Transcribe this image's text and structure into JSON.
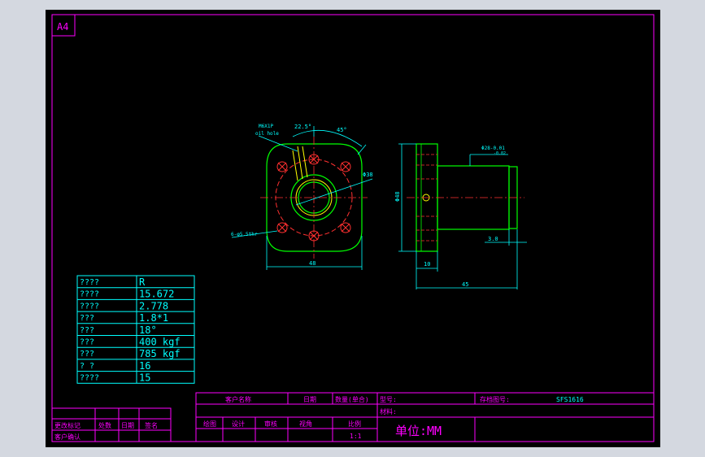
{
  "sheet": {
    "size_label": "A4"
  },
  "parameter_table": {
    "rows": [
      {
        "label": "????",
        "value": "R"
      },
      {
        "label": "????",
        "value": "15.672"
      },
      {
        "label": "????",
        "value": "2.778"
      },
      {
        "label": "???",
        "value": "1.8*1"
      },
      {
        "label": "???",
        "value": "18°"
      },
      {
        "label": "???",
        "value": "400 kgf"
      },
      {
        "label": "???",
        "value": "785 kgf"
      },
      {
        "label": "? ?",
        "value": "16"
      },
      {
        "label": "????",
        "value": "15"
      }
    ]
  },
  "front_view": {
    "oil_hole_note_line1": "M6X1P",
    "oil_hole_note_line2": "oil hole",
    "angle_small": "22.5°",
    "angle_large": "45°",
    "pcd_label": "Φ38",
    "holes_note": "6-φ5.5thr",
    "width_dim": "48"
  },
  "side_view": {
    "shaft_dia": "Φ28-0.01",
    "shaft_tol": "-0.02",
    "height_dim": "Φ48",
    "chamfer_dim": "3.0",
    "flange_dim": "10",
    "length_dim": "45"
  },
  "revision_block": {
    "change_mark": "更改标记",
    "location": "处数",
    "date": "日期",
    "signature": "签名",
    "customer_confirm": "客户确认"
  },
  "title_block": {
    "customer_name": "客户名称",
    "date": "日期",
    "quantity": "数量(单合)",
    "model_label": "型号:",
    "drawing_no_label": "存档图号:",
    "drawing_no": "SFS1616",
    "material_label": "材料:",
    "drawn": "绘图",
    "designed": "设计",
    "checked": "审核",
    "approved": "视角",
    "scale_label": "比例",
    "scale": "1:1",
    "unit": "单位:MM"
  },
  "colors": {
    "background": "#000000",
    "border": "#ff00ff",
    "geometry": "#00ff00",
    "dimension": "#00ffff",
    "hidden": "#ff3030",
    "center": "#ffff00"
  }
}
